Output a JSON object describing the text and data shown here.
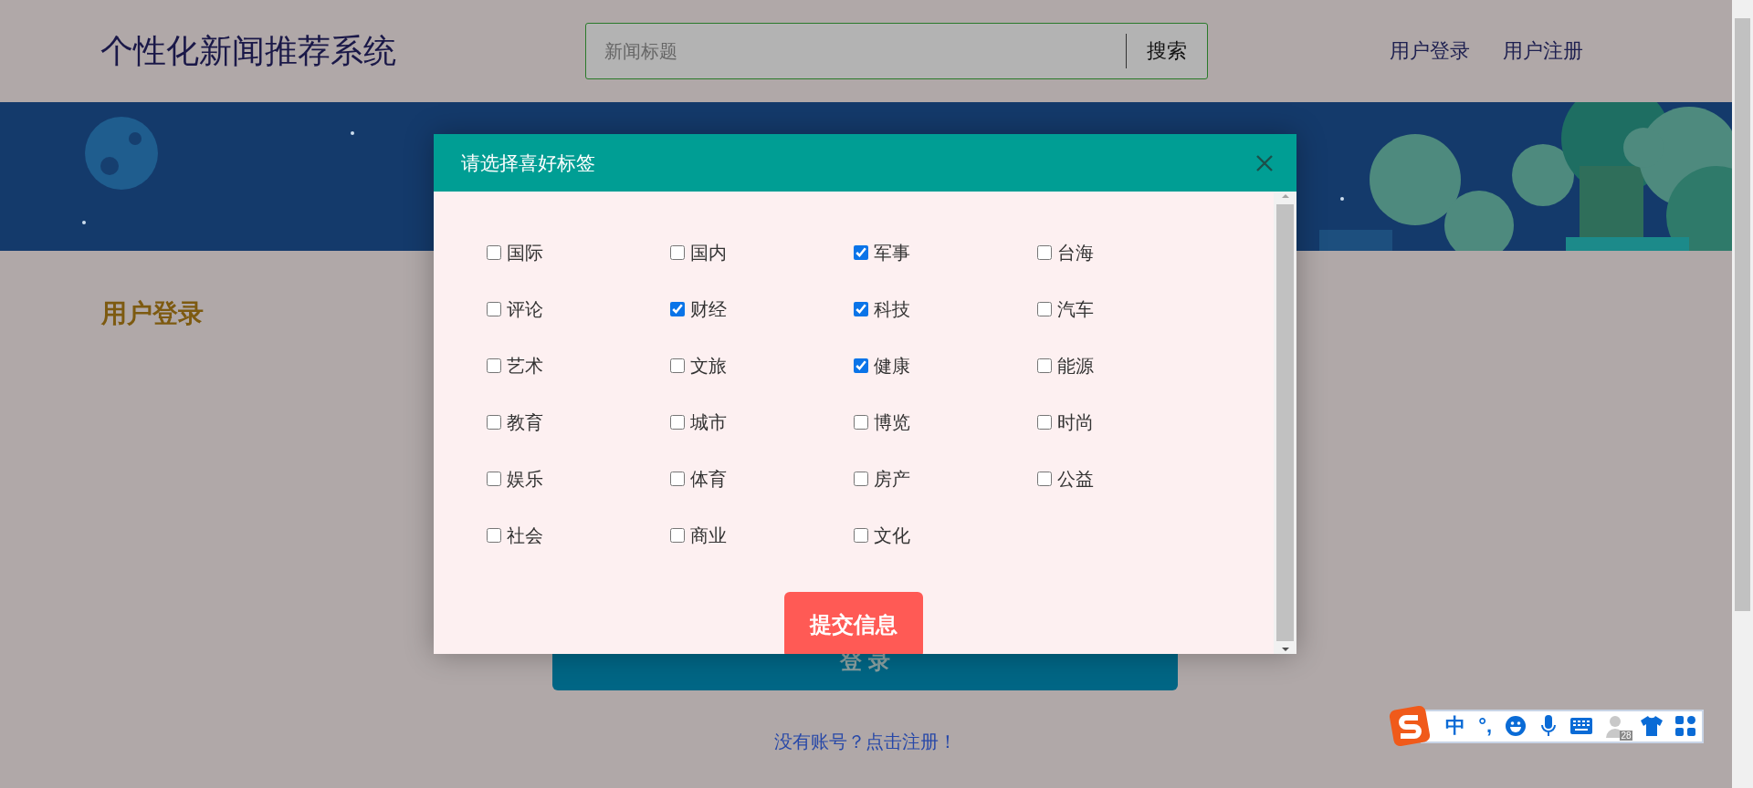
{
  "header": {
    "title": "个性化新闻推荐系统",
    "search": {
      "placeholder": "新闻标题",
      "button": "搜索"
    },
    "nav": [
      "用户登录",
      "用户注册"
    ]
  },
  "login": {
    "heading": "用户登录",
    "button": "登 录",
    "register_link": "没有账号？点击注册！"
  },
  "modal": {
    "title": "请选择喜好标签",
    "tags": [
      {
        "label": "国际",
        "checked": false
      },
      {
        "label": "国内",
        "checked": false
      },
      {
        "label": "军事",
        "checked": true
      },
      {
        "label": "台海",
        "checked": false
      },
      {
        "label": "评论",
        "checked": false
      },
      {
        "label": "财经",
        "checked": true
      },
      {
        "label": "科技",
        "checked": true
      },
      {
        "label": "汽车",
        "checked": false
      },
      {
        "label": "艺术",
        "checked": false
      },
      {
        "label": "文旅",
        "checked": false
      },
      {
        "label": "健康",
        "checked": true
      },
      {
        "label": "能源",
        "checked": false
      },
      {
        "label": "教育",
        "checked": false
      },
      {
        "label": "城市",
        "checked": false
      },
      {
        "label": "博览",
        "checked": false
      },
      {
        "label": "时尚",
        "checked": false
      },
      {
        "label": "娱乐",
        "checked": false
      },
      {
        "label": "体育",
        "checked": false
      },
      {
        "label": "房产",
        "checked": false
      },
      {
        "label": "公益",
        "checked": false
      },
      {
        "label": "社会",
        "checked": false
      },
      {
        "label": "商业",
        "checked": false
      },
      {
        "label": "文化",
        "checked": false
      }
    ],
    "submit": "提交信息"
  },
  "ime_toolbar": {
    "mode": "中",
    "punctuation": "°,",
    "badge": "28"
  }
}
